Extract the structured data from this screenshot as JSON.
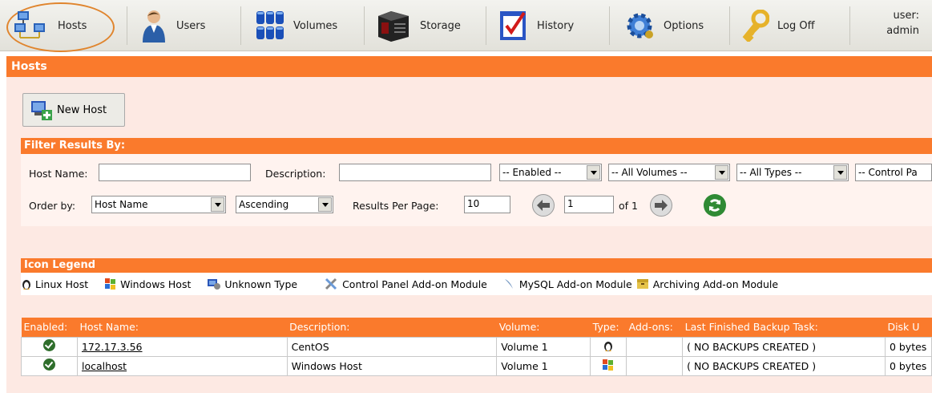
{
  "nav": {
    "items": [
      {
        "label": "Hosts",
        "icon": "hosts-icon"
      },
      {
        "label": "Users",
        "icon": "users-icon"
      },
      {
        "label": "Volumes",
        "icon": "volumes-icon"
      },
      {
        "label": "Storage",
        "icon": "storage-icon"
      },
      {
        "label": "History",
        "icon": "history-icon"
      },
      {
        "label": "Options",
        "icon": "options-gear-icon"
      },
      {
        "label": "Log Off",
        "icon": "key-icon"
      }
    ],
    "user_label": "user:",
    "user_name": "admin"
  },
  "panel": {
    "title": "Hosts",
    "new_host_label": "New Host"
  },
  "filter": {
    "title": "Filter Results By:",
    "host_name_label": "Host Name:",
    "host_name_value": "",
    "description_label": "Description:",
    "description_value": "",
    "enabled_select": "-- Enabled --",
    "volumes_select": "-- All Volumes --",
    "types_select": "-- All Types --",
    "control_panel_select": "-- Control Pa",
    "order_by_label": "Order by:",
    "order_by_value": "Host Name",
    "direction_value": "Ascending",
    "results_per_page_label": "Results Per Page:",
    "results_per_page_value": "10",
    "page_value": "1",
    "page_of": "of 1"
  },
  "legend": {
    "title": "Icon Legend",
    "items": [
      {
        "label": "Linux Host",
        "icon": "linux-penguin-icon"
      },
      {
        "label": "Windows Host",
        "icon": "windows-flag-icon"
      },
      {
        "label": "Unknown Type",
        "icon": "unknown-type-icon"
      },
      {
        "label": "Control Panel Add-on Module",
        "icon": "control-panel-tools-icon"
      },
      {
        "label": "MySQL Add-on Module",
        "icon": "mysql-dolphin-icon"
      },
      {
        "label": "Archiving Add-on Module",
        "icon": "archiving-icon"
      }
    ]
  },
  "table": {
    "columns": [
      "Enabled:",
      "Host Name:",
      "Description:",
      "Volume:",
      "Type:",
      "Add-ons:",
      "Last Finished Backup Task:",
      "Disk U"
    ],
    "rows": [
      {
        "host": "172.17.3.56",
        "description": "CentOS",
        "volume": "Volume 1",
        "type_icon": "linux-penguin-icon",
        "addons": "",
        "last_backup": "( NO BACKUPS CREATED )",
        "disk": "0 bytes"
      },
      {
        "host": "localhost",
        "description": "Windows Host",
        "volume": "Volume 1",
        "type_icon": "windows-flag-icon",
        "addons": "",
        "last_backup": "( NO BACKUPS CREATED )",
        "disk": "0 bytes"
      }
    ]
  },
  "colors": {
    "accent": "#fa7a2c",
    "panel_bg": "#fde9e3",
    "highlight_ring": "#e0852e"
  }
}
